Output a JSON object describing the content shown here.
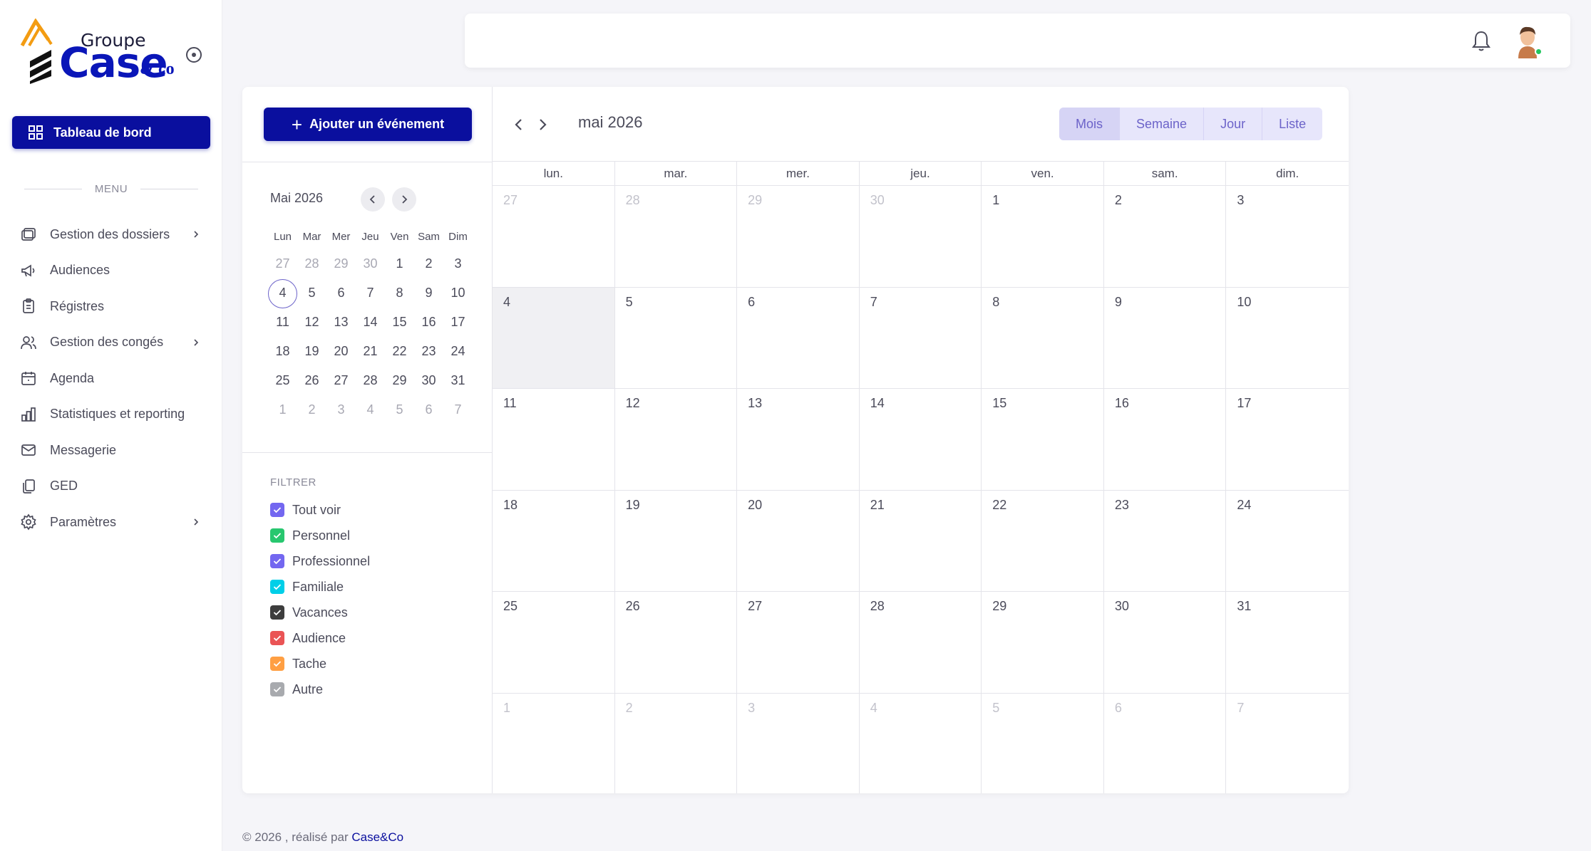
{
  "brand": {
    "groupe": "Groupe",
    "case": "Case",
    "co": "& co"
  },
  "sidebar": {
    "dashboard_label": "Tableau de bord",
    "menu_label": "MENU",
    "items": [
      {
        "label": "Gestion des dossiers",
        "icon": "folders-icon",
        "has_submenu": true
      },
      {
        "label": "Audiences",
        "icon": "megaphone-icon",
        "has_submenu": false
      },
      {
        "label": "Régistres",
        "icon": "clipboard-icon",
        "has_submenu": false
      },
      {
        "label": "Gestion des congés",
        "icon": "users-icon",
        "has_submenu": true
      },
      {
        "label": "Agenda",
        "icon": "calendar-icon",
        "has_submenu": false
      },
      {
        "label": "Statistiques et reporting",
        "icon": "bar-chart-icon",
        "has_submenu": false
      },
      {
        "label": "Messagerie",
        "icon": "mail-icon",
        "has_submenu": false
      },
      {
        "label": "GED",
        "icon": "documents-icon",
        "has_submenu": false
      },
      {
        "label": "Paramètres",
        "icon": "gear-icon",
        "has_submenu": true
      }
    ]
  },
  "header": {
    "notification_icon": "bell-icon",
    "avatar_status": "online"
  },
  "calendar": {
    "add_event_label": "Ajouter un événement",
    "month_title": "mai 2026",
    "views": [
      "Mois",
      "Semaine",
      "Jour",
      "Liste"
    ],
    "active_view": "Mois",
    "weekdays": [
      "lun.",
      "mar.",
      "mer.",
      "jeu.",
      "ven.",
      "sam.",
      "dim."
    ],
    "weeks": [
      [
        {
          "d": "27",
          "off": true
        },
        {
          "d": "28",
          "off": true
        },
        {
          "d": "29",
          "off": true
        },
        {
          "d": "30",
          "off": true
        },
        {
          "d": "1"
        },
        {
          "d": "2"
        },
        {
          "d": "3"
        }
      ],
      [
        {
          "d": "4",
          "sel": true
        },
        {
          "d": "5"
        },
        {
          "d": "6"
        },
        {
          "d": "7"
        },
        {
          "d": "8"
        },
        {
          "d": "9"
        },
        {
          "d": "10"
        }
      ],
      [
        {
          "d": "11"
        },
        {
          "d": "12"
        },
        {
          "d": "13"
        },
        {
          "d": "14"
        },
        {
          "d": "15"
        },
        {
          "d": "16"
        },
        {
          "d": "17"
        }
      ],
      [
        {
          "d": "18"
        },
        {
          "d": "19"
        },
        {
          "d": "20"
        },
        {
          "d": "21"
        },
        {
          "d": "22"
        },
        {
          "d": "23"
        },
        {
          "d": "24"
        }
      ],
      [
        {
          "d": "25"
        },
        {
          "d": "26"
        },
        {
          "d": "27"
        },
        {
          "d": "28"
        },
        {
          "d": "29"
        },
        {
          "d": "30"
        },
        {
          "d": "31"
        }
      ],
      [
        {
          "d": "1",
          "off": true
        },
        {
          "d": "2",
          "off": true
        },
        {
          "d": "3",
          "off": true
        },
        {
          "d": "4",
          "off": true
        },
        {
          "d": "5",
          "off": true
        },
        {
          "d": "6",
          "off": true
        },
        {
          "d": "7",
          "off": true
        }
      ]
    ]
  },
  "mini_calendar": {
    "title": "Mai 2026",
    "weekdays": [
      "Lun",
      "Mar",
      "Mer",
      "Jeu",
      "Ven",
      "Sam",
      "Dim"
    ],
    "weeks": [
      [
        {
          "d": "27",
          "off": true
        },
        {
          "d": "28",
          "off": true
        },
        {
          "d": "29",
          "off": true
        },
        {
          "d": "30",
          "off": true
        },
        {
          "d": "1"
        },
        {
          "d": "2"
        },
        {
          "d": "3"
        }
      ],
      [
        {
          "d": "4",
          "today": true
        },
        {
          "d": "5"
        },
        {
          "d": "6"
        },
        {
          "d": "7"
        },
        {
          "d": "8"
        },
        {
          "d": "9"
        },
        {
          "d": "10"
        }
      ],
      [
        {
          "d": "11"
        },
        {
          "d": "12"
        },
        {
          "d": "13"
        },
        {
          "d": "14"
        },
        {
          "d": "15"
        },
        {
          "d": "16"
        },
        {
          "d": "17"
        }
      ],
      [
        {
          "d": "18"
        },
        {
          "d": "19"
        },
        {
          "d": "20"
        },
        {
          "d": "21"
        },
        {
          "d": "22"
        },
        {
          "d": "23"
        },
        {
          "d": "24"
        }
      ],
      [
        {
          "d": "25"
        },
        {
          "d": "26"
        },
        {
          "d": "27"
        },
        {
          "d": "28"
        },
        {
          "d": "29"
        },
        {
          "d": "30"
        },
        {
          "d": "31"
        }
      ],
      [
        {
          "d": "1",
          "off": true
        },
        {
          "d": "2",
          "off": true
        },
        {
          "d": "3",
          "off": true
        },
        {
          "d": "4",
          "off": true
        },
        {
          "d": "5",
          "off": true
        },
        {
          "d": "6",
          "off": true
        },
        {
          "d": "7",
          "off": true
        }
      ]
    ]
  },
  "filters": {
    "title": "FILTRER",
    "items": [
      {
        "label": "Tout voir",
        "color": "#7367f0",
        "checked": true
      },
      {
        "label": "Personnel",
        "color": "#28c76f",
        "checked": true
      },
      {
        "label": "Professionnel",
        "color": "#7367f0",
        "checked": true
      },
      {
        "label": "Familiale",
        "color": "#00cfe8",
        "checked": true
      },
      {
        "label": "Vacances",
        "color": "#3d3d3d",
        "checked": true
      },
      {
        "label": "Audience",
        "color": "#ea5455",
        "checked": true
      },
      {
        "label": "Tache",
        "color": "#ff9f43",
        "checked": true
      },
      {
        "label": "Autre",
        "color": "#a8aaae",
        "checked": true
      }
    ]
  },
  "footer": {
    "text": "© 2026 , réalisé par ",
    "link": "Case&Co"
  },
  "colors": {
    "primary": "#0a0f9e",
    "accent": "#6c63c9",
    "view_bg": "#e7e6fb"
  }
}
